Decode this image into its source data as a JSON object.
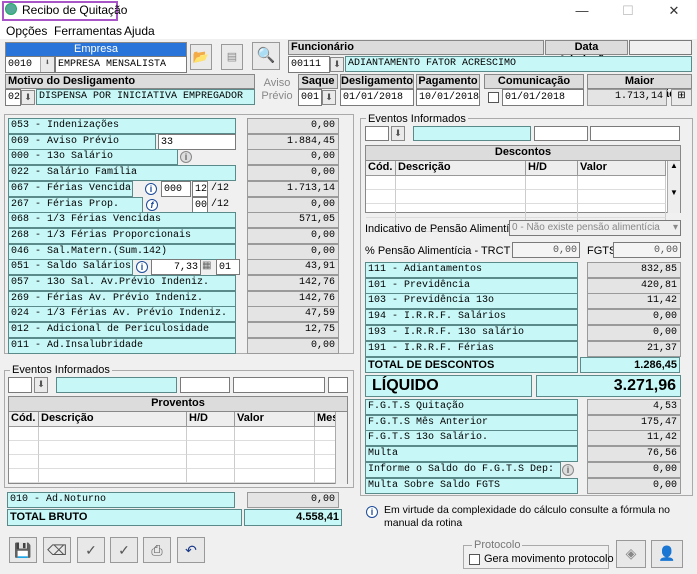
{
  "window": {
    "title": "Recibo de Quitação",
    "minimize": "—",
    "maximize": "☐",
    "close": "✕"
  },
  "menu": {
    "opcoes": "Opções",
    "ferramentas": "Ferramentas",
    "ajuda": "Ajuda"
  },
  "empresa": {
    "label": "Empresa",
    "code": "0010",
    "name": "EMPRESA MENSALISTA"
  },
  "funcionario": {
    "label": "Funcionário",
    "code": "00111",
    "name": "ADIANTAMENTO FATOR ACRESCIMO"
  },
  "admissao": {
    "label": "Data Admissão:",
    "value": ""
  },
  "motivo": {
    "label": "Motivo do Desligamento",
    "code": "02",
    "name": "DISPENSA POR INICIATIVA EMPREGADOR"
  },
  "aviso_previo": {
    "line1": "Aviso",
    "line2": "Prévio"
  },
  "saque": {
    "label": "Saque",
    "value": "001"
  },
  "desligamento": {
    "label": "Desligamento",
    "value": "01/01/2018"
  },
  "pagamento": {
    "label": "Pagamento",
    "value": "10/01/2018"
  },
  "comunicacao": {
    "label": "Comunicação Aviso",
    "value": "01/01/2018"
  },
  "maior_rem": {
    "label": "Maior Remuneração",
    "value": "1.713,14"
  },
  "proventos_list": [
    {
      "label": "053 - Indenizações",
      "value": "0,00"
    },
    {
      "label": "069 - Aviso Prévio",
      "extra": "33",
      "value": "1.884,45"
    },
    {
      "label": "000 - 13o Salário",
      "value": "0,00"
    },
    {
      "label": "022 - Salário Família",
      "value": "0,00"
    },
    {
      "label": "067 - Férias Vencidas",
      "a": "000",
      "b": "12",
      "c": "/12",
      "value": "1.713,14"
    },
    {
      "label": "267 - Férias Prop.",
      "b": "00",
      "c": "/12",
      "value": "0,00"
    },
    {
      "label": "068 - 1/3 Férias Vencidas",
      "value": "571,05"
    },
    {
      "label": "268 - 1/3 Férias Proporcionais",
      "value": "0,00"
    },
    {
      "label": "046 - Sal.Matern.(Sum.142)",
      "value": "0,00"
    },
    {
      "label": "051 - Saldo Salários",
      "a": "7,33",
      "b": "01",
      "value": "43,91"
    },
    {
      "label": "057 - 13o Sal. Av.Prévio Indeniz.",
      "value": "142,76"
    },
    {
      "label": "269 - Férias  Av. Prévio Indeniz.",
      "value": "142,76"
    },
    {
      "label": "024 - 1/3 Férias Av. Prévio Indeniz.",
      "value": "47,59"
    },
    {
      "label": "012 - Adicional de Periculosidade",
      "value": "12,75"
    },
    {
      "label": "011 - Ad.Insalubridade",
      "value": "0,00"
    }
  ],
  "eventos_left": {
    "title": "Eventos Informados",
    "grid_title": "Proventos",
    "cols": [
      "Cód.",
      "Descrição",
      "H/D",
      "Valor",
      "Mes"
    ]
  },
  "ad_noturno": {
    "label": "010 - Ad.Noturno",
    "value": "0,00"
  },
  "total_bruto": {
    "label": "TOTAL BRUTO",
    "value": "4.558,41"
  },
  "eventos_right": {
    "title": "Eventos Informados",
    "grid_title": "Descontos",
    "cols": [
      "Cód.",
      "Descrição",
      "H/D",
      "Valor"
    ]
  },
  "pensao": {
    "label": "Indicativo de Pensão Alimentícia",
    "value": "0 - Não existe pensão alimentícia",
    "pct_label": "% Pensão Alimentícia - TRCT",
    "pct_value": "0,00",
    "fgts_label": "FGTS",
    "fgts_value": "0,00"
  },
  "descontos_list": [
    {
      "label": "111 - Adiantamentos",
      "value": "832,85"
    },
    {
      "label": "101 - Previdência",
      "value": "420,81"
    },
    {
      "label": "103 - Previdência 13o",
      "value": "11,42"
    },
    {
      "label": "194 - I.R.R.F. Salários",
      "value": "0,00"
    },
    {
      "label": "193 - I.R.R.F. 13o salário",
      "value": "0,00"
    },
    {
      "label": "191 - I.R.R.F. Férias",
      "value": "21,37"
    }
  ],
  "total_descontos": {
    "label": "TOTAL DE DESCONTOS",
    "value": "1.286,45"
  },
  "liquido": {
    "label": "LÍQUIDO",
    "value": "3.271,96"
  },
  "fgts_list": [
    {
      "label": "F.G.T.S  Quitação",
      "value": "4,53"
    },
    {
      "label": "F.G.T.S  Mês Anterior",
      "value": "175,47"
    },
    {
      "label": "F.G.T.S  13o Salário.",
      "value": "11,42"
    },
    {
      "label": "Multa",
      "value": "76,56"
    },
    {
      "label": "Informe o Saldo do F.G.T.S Dep:",
      "value": "0,00"
    },
    {
      "label": "Multa Sobre Saldo FGTS",
      "value": "0,00"
    }
  ],
  "info": {
    "text": "Em virtude da complexidade do cálculo consulte a fórmula no manual da rotina"
  },
  "protocolo": {
    "title": "Protocolo",
    "checkbox": "Gera movimento protocolo"
  },
  "colors": {
    "cyan": "#c8f7f7",
    "blue_header": "#2874d8",
    "title_highlight": "#a855c8"
  }
}
